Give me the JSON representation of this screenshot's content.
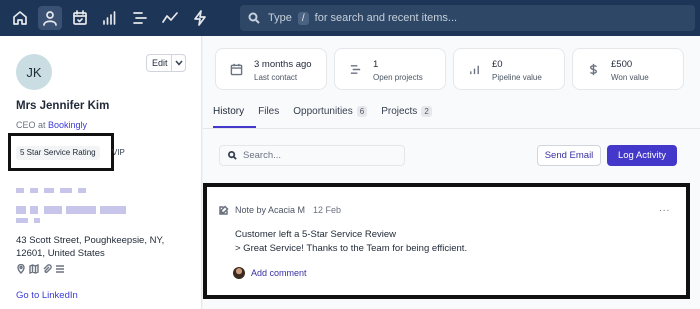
{
  "topbar": {
    "nav_icons": [
      "home-icon",
      "user-icon",
      "calendar-icon",
      "chart-bar-icon",
      "list-icon",
      "trend-icon",
      "lightning-icon"
    ],
    "search": {
      "prefix": "Type",
      "key": "/",
      "suffix": "for search and recent items..."
    }
  },
  "contact": {
    "initials": "JK",
    "edit_label": "Edit",
    "name": "Mrs Jennifer Kim",
    "role": "CEO at",
    "company": "Bookingly",
    "tags": [
      "5 Star Service Rating",
      "VIP"
    ],
    "address_line1": "43 Scott Street, Poughkeepsie, NY,",
    "address_line2": "12601, United States",
    "linkedin": "Go to LinkedIn"
  },
  "stats": [
    {
      "value": "3 months ago",
      "label": "Last contact",
      "icon": "calendar-icon"
    },
    {
      "value": "1",
      "label": "Open projects",
      "icon": "list-icon"
    },
    {
      "value": "£0",
      "label": "Pipeline value",
      "icon": "chart-bar-icon"
    },
    {
      "value": "£500",
      "label": "Won value",
      "icon": "dollar-icon"
    }
  ],
  "tabs": [
    {
      "label": "History",
      "badge": ""
    },
    {
      "label": "Files",
      "badge": ""
    },
    {
      "label": "Opportunities",
      "badge": "6"
    },
    {
      "label": "Projects",
      "badge": "2"
    }
  ],
  "activity": {
    "search_placeholder": "Search...",
    "send_email": "Send Email",
    "log_activity": "Log Activity"
  },
  "note": {
    "author": "Note by Acacia M",
    "date": "12 Feb",
    "more": "...",
    "line1": "Customer left a 5-Star Service Review",
    "line2": "> Great Service! Thanks to the Team for being efficient.",
    "add_comment": "Add comment"
  }
}
